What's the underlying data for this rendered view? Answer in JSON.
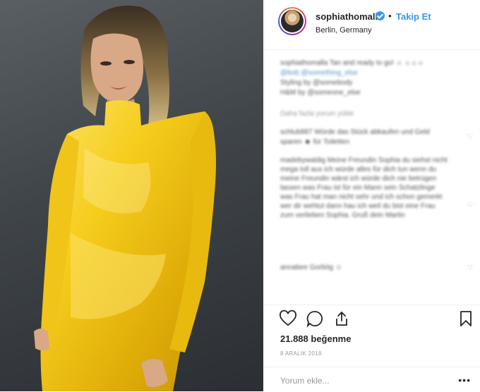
{
  "post": {
    "username": "sophiathomalla",
    "follow_label": "Takip Et",
    "separator": "•",
    "location": "Berlin, Germany",
    "likes": "21.888 beğenme",
    "date": "8 ARALIK 2018"
  },
  "comment_box": {
    "placeholder": "Yorum ekle...",
    "more_label": "•••"
  },
  "icons": {
    "verified": "verified-badge-icon",
    "like": "heart-icon",
    "comment": "comment-icon",
    "share": "share-icon",
    "save": "bookmark-icon",
    "options": "more-options-icon"
  },
  "colors": {
    "accent": "#3897f0",
    "dress": "#f2c81e",
    "background": "#3f4448"
  }
}
